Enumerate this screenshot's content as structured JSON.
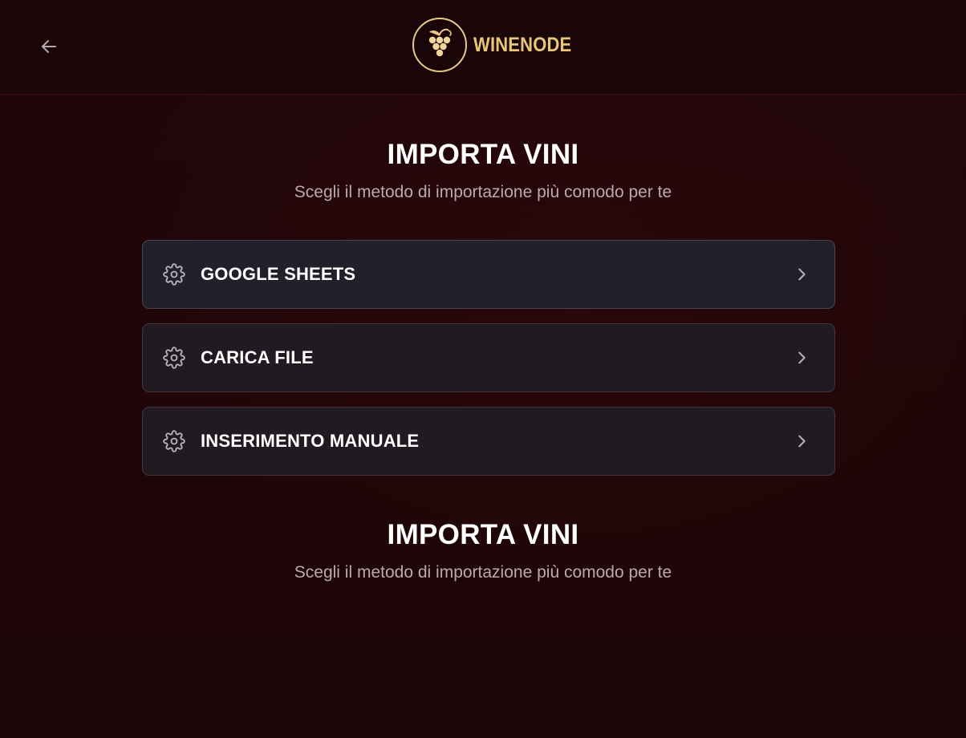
{
  "header": {
    "back_icon": "arrow-left-icon",
    "logo_icon": "grapes-icon",
    "logo_text": "WINENODE"
  },
  "sections": [
    {
      "title": "IMPORTA VINI",
      "subtitle": "Scegli il metodo di importazione più comodo per te"
    },
    {
      "title": "IMPORTA VINI",
      "subtitle": "Scegli il metodo di importazione più comodo per te"
    }
  ],
  "options": [
    {
      "label": "GOOGLE SHEETS",
      "icon": "gear-icon",
      "trailing_icon": "chevron-right-icon"
    },
    {
      "label": "CARICA FILE",
      "icon": "gear-icon",
      "trailing_icon": "chevron-right-icon"
    },
    {
      "label": "INSERIMENTO MANUALE",
      "icon": "gear-icon",
      "trailing_icon": "chevron-right-icon"
    }
  ],
  "colors": {
    "background": "#21060a",
    "header": "#1a0608",
    "brand_gold": "#e9c57a",
    "card": "#22202b",
    "subtitle": "#b9aab0"
  }
}
